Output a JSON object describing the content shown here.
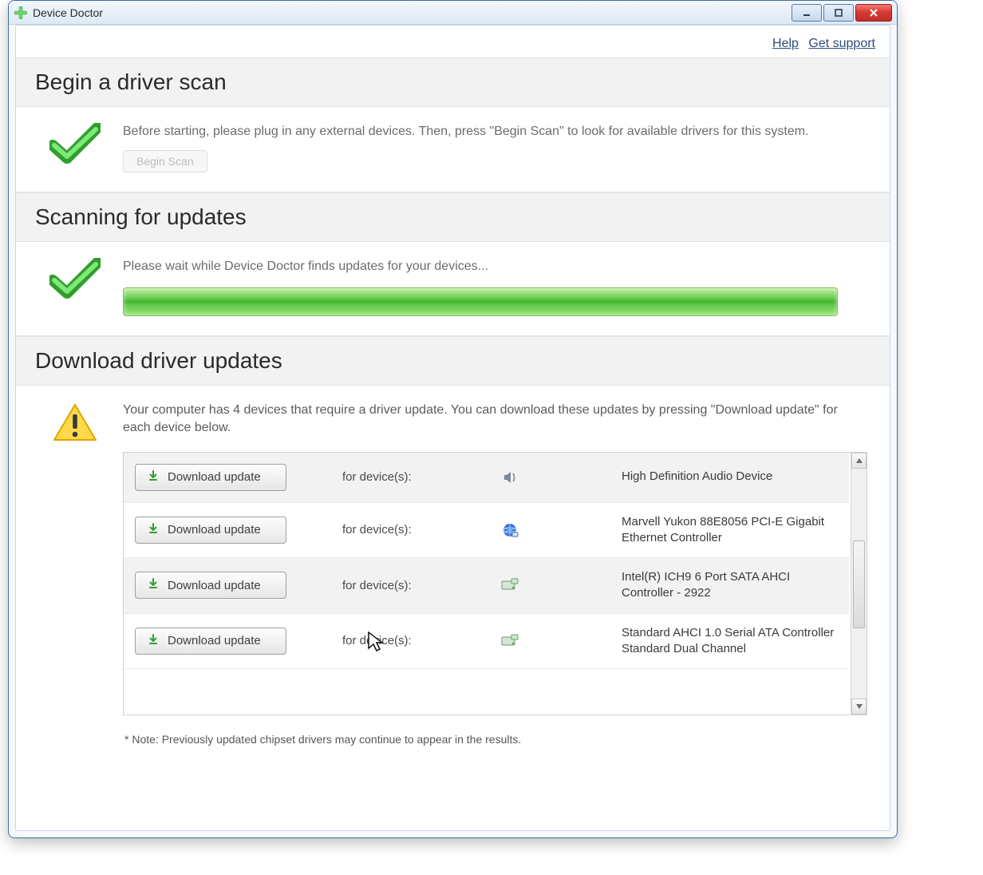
{
  "window": {
    "title": "Device Doctor"
  },
  "toplinks": {
    "help": "Help",
    "support": "Get support"
  },
  "scan": {
    "heading": "Begin a driver scan",
    "instructions": "Before starting, please plug in any external devices. Then, press \"Begin Scan\" to look for available drivers for this system.",
    "button": "Begin Scan"
  },
  "scanning": {
    "heading": "Scanning for updates",
    "status": "Please wait while Device Doctor finds updates for your devices..."
  },
  "download": {
    "heading": "Download driver updates",
    "summary": "Your computer has 4 devices that require a driver update. You can download these updates by pressing \"Download update\" for each device below.",
    "for_label": "for device(s):",
    "button_label": "Download update",
    "note": "* Note: Previously updated chipset drivers may continue to appear in the results.",
    "items": [
      {
        "icon": "speaker-icon",
        "name": "High Definition Audio Device"
      },
      {
        "icon": "network-icon",
        "name": "Marvell Yukon 88E8056 PCI-E Gigabit Ethernet Controller"
      },
      {
        "icon": "storage-icon",
        "name": "Intel(R) ICH9 6 Port SATA AHCI Controller - 2922"
      },
      {
        "icon": "storage-icon",
        "name": "Standard AHCI 1.0 Serial ATA Controller\nStandard Dual Channel"
      }
    ]
  }
}
